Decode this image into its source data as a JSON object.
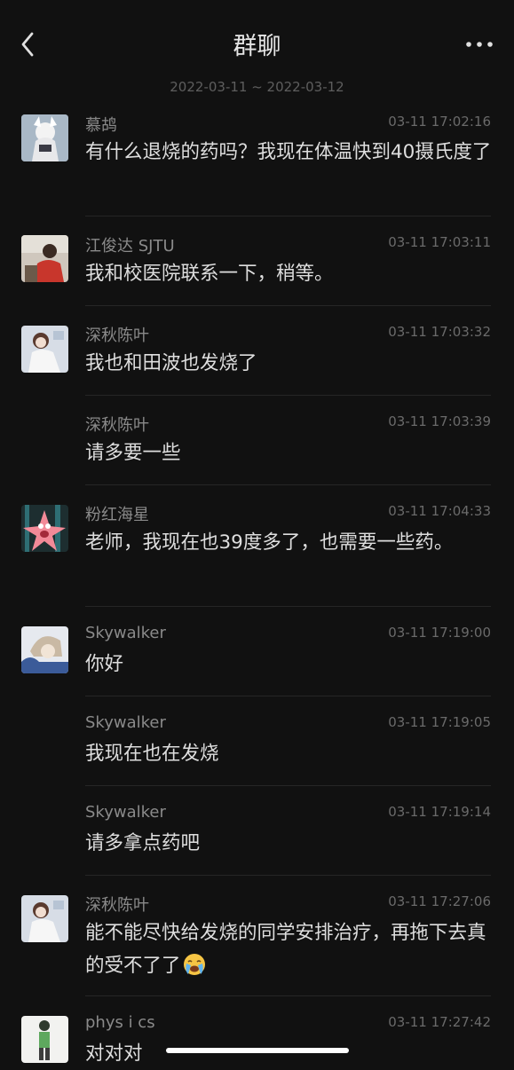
{
  "header": {
    "title": "群聊",
    "date_range": "2022-03-11 ~ 2022-03-12"
  },
  "messages": [
    {
      "name": "慕鸪",
      "time": "03-11 17:02:16",
      "text": "有什么退烧的药吗？我现在体温快到40摄氏度了",
      "avatar": "anime-white-hair-avatar"
    },
    {
      "name": "江俊达 SJTU",
      "time": "03-11 17:03:11",
      "text": "我和校医院联系一下，稍等。",
      "avatar": "person-red-shirt-avatar"
    },
    {
      "name": "深秋陈叶",
      "time": "03-11 17:03:32",
      "text": "我也和田波也发烧了",
      "avatar": "anime-girl-avatar"
    },
    {
      "name": "深秋陈叶",
      "time": "03-11 17:03:39",
      "text": "请多要一些"
    },
    {
      "name": "粉红海星",
      "time": "03-11 17:04:33",
      "text": "老师，我现在也39度多了，也需要一些药。",
      "avatar": "pink-starfish-avatar"
    },
    {
      "name": "Skywalker",
      "time": "03-11 17:19:00",
      "text": "你好",
      "avatar": "anime-boy-avatar"
    },
    {
      "name": "Skywalker",
      "time": "03-11 17:19:05",
      "text": "我现在也在发烧"
    },
    {
      "name": "Skywalker",
      "time": "03-11 17:19:14",
      "text": "请多拿点药吧"
    },
    {
      "name": "深秋陈叶",
      "time": "03-11 17:27:06",
      "text": "能不能尽快给发烧的同学安排治疗，再拖下去真的受不了了",
      "avatar": "anime-girl-avatar",
      "emoji": "crying-face"
    },
    {
      "name": "phys i cs",
      "time": "03-11 17:27:42",
      "text": "对对对",
      "avatar": "green-figure-avatar"
    }
  ]
}
